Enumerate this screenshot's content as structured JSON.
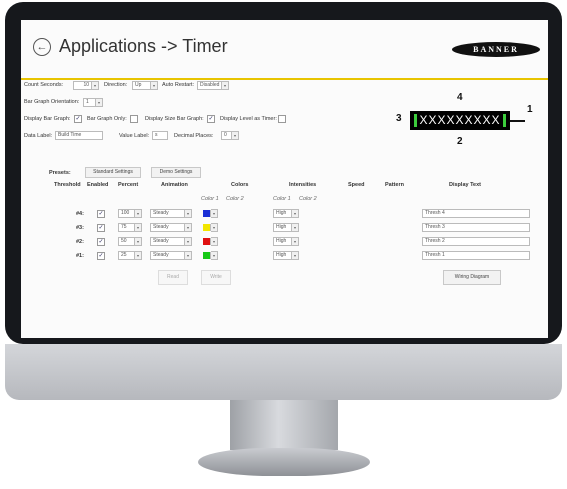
{
  "app": {
    "title": "Applications -> Timer",
    "logo": "BANNER"
  },
  "settings": {
    "count_seconds_label": "Count Seconds:",
    "count_seconds_value": "10",
    "direction_label": "Direction:",
    "direction_value": "Up",
    "auto_restart_label": "Auto Restart:",
    "auto_restart_value": "Disabled",
    "bar_graph_orientation_label": "Bar Graph Orientation:",
    "bar_graph_orientation_value": "1",
    "display_bar_graph_label": "Display Bar Graph:",
    "bar_graph_only_label": "Bar Graph Only:",
    "display_size_bar_graph_label": "Display Size Bar Graph:",
    "display_level_as_timer_label": "Display Level as Timer:",
    "data_label_label": "Data Label:",
    "data_label_value": "Build Time",
    "value_label_label": "Value Label:",
    "value_label_value": "s",
    "decimal_places_label": "Decimal Places:",
    "decimal_places_value": "0"
  },
  "preview": {
    "text": "XXXXXXXXX",
    "callout_top": "4",
    "callout_right": "1",
    "callout_left": "3",
    "callout_bottom": "2"
  },
  "presets": {
    "label": "Presets:",
    "standard": "Standard Settings",
    "demo": "Demo Settings"
  },
  "table": {
    "headers": {
      "threshold": "Threshold",
      "enabled": "Enabled",
      "percent": "Percent",
      "animation": "Animation",
      "colors": "Colors",
      "intensities": "Intensities",
      "speed": "Speed",
      "pattern": "Pattern",
      "display_text": "Display Text"
    },
    "subheaders": {
      "color1": "Color 1",
      "color2": "Color 2",
      "color1b": "Color 1",
      "color2b": "Color 2"
    },
    "rows": [
      {
        "id": "#4:",
        "percent": "100",
        "animation": "Steady",
        "color": "#1a2fd6",
        "intensity": "High",
        "text": "Thresh 4"
      },
      {
        "id": "#3:",
        "percent": "75",
        "animation": "Steady",
        "color": "#f2e600",
        "intensity": "High",
        "text": "Thresh 3"
      },
      {
        "id": "#2:",
        "percent": "50",
        "animation": "Steady",
        "color": "#e01010",
        "intensity": "High",
        "text": "Thresh 2"
      },
      {
        "id": "#1:",
        "percent": "25",
        "animation": "Steady",
        "color": "#17c917",
        "intensity": "High",
        "text": "Thresh 1"
      }
    ]
  },
  "buttons": {
    "read": "Read",
    "write": "Write",
    "wiring": "Wiring Diagram"
  }
}
